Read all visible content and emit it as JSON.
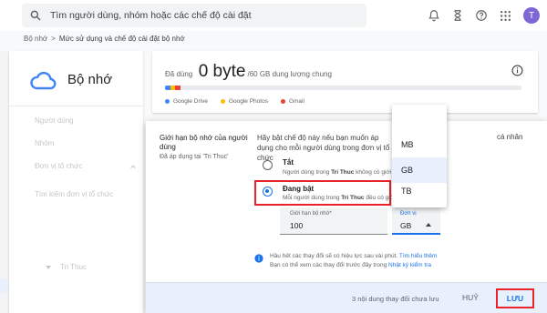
{
  "search": {
    "placeholder": "Tìm người dùng, nhóm hoặc các chế độ cài đặt"
  },
  "user": {
    "initial": "T"
  },
  "breadcrumb": {
    "root": "Bộ nhớ",
    "separator": ">",
    "current": "Mức sử dụng và chế độ cài đặt bộ nhớ"
  },
  "left": {
    "title": "Bộ nhớ",
    "nav": [
      "Người dùng",
      "Nhóm",
      "Đơn vị tổ chức",
      "Tìm kiếm đơn vị tổ chức"
    ],
    "tree_item": "Tri Thuc"
  },
  "storage": {
    "used_prefix": "Đã dùng",
    "used_value": "0 byte",
    "used_suffix": "/60 GB dung lượng chung",
    "legend": [
      {
        "label": "Google Drive",
        "color": "#4285f4"
      },
      {
        "label": "Google Photos",
        "color": "#fbbc04"
      },
      {
        "label": "Gmail",
        "color": "#ea4335"
      }
    ]
  },
  "dialog": {
    "title": "Giới hạn bộ nhớ của người dùng",
    "subtitle": "Đã áp dụng tại 'Tri Thuc'",
    "description": "Hãy bật chế độ này nếu bạn muốn áp dụng cho mỗi người dùng trong đơn vị tổ chức",
    "description_tail": "cá nhân",
    "options": [
      {
        "label": "Tắt",
        "desc_prefix": "Người dùng trong ",
        "desc_bold": "Tri Thuc",
        "desc_suffix": " không có giới h",
        "selected": false
      },
      {
        "label": "Đang bật",
        "desc_prefix": "Mỗi người dùng trong ",
        "desc_bold": "Tri Thuc",
        "desc_suffix": " đều có giới",
        "selected": true
      }
    ],
    "limit": {
      "label": "Giới hạn bộ nhớ*",
      "value": "100"
    },
    "unit": {
      "label": "Đơn vị",
      "value": "GB"
    },
    "note": {
      "line1": "Hầu hết các thay đổi sẽ có hiệu lực sau vài phút. ",
      "line1_link": "Tìm hiểu thêm",
      "line2": "Bạn có thể xem các thay đổi trước đây trong ",
      "line2_link": "Nhật ký kiểm tra"
    },
    "footer": {
      "status": "3 nội dung thay đổi chưa lưu",
      "cancel": "HUỶ",
      "save": "LƯU"
    }
  },
  "unit_menu": {
    "items": [
      "MB",
      "GB",
      "TB"
    ],
    "selected": "GB"
  }
}
